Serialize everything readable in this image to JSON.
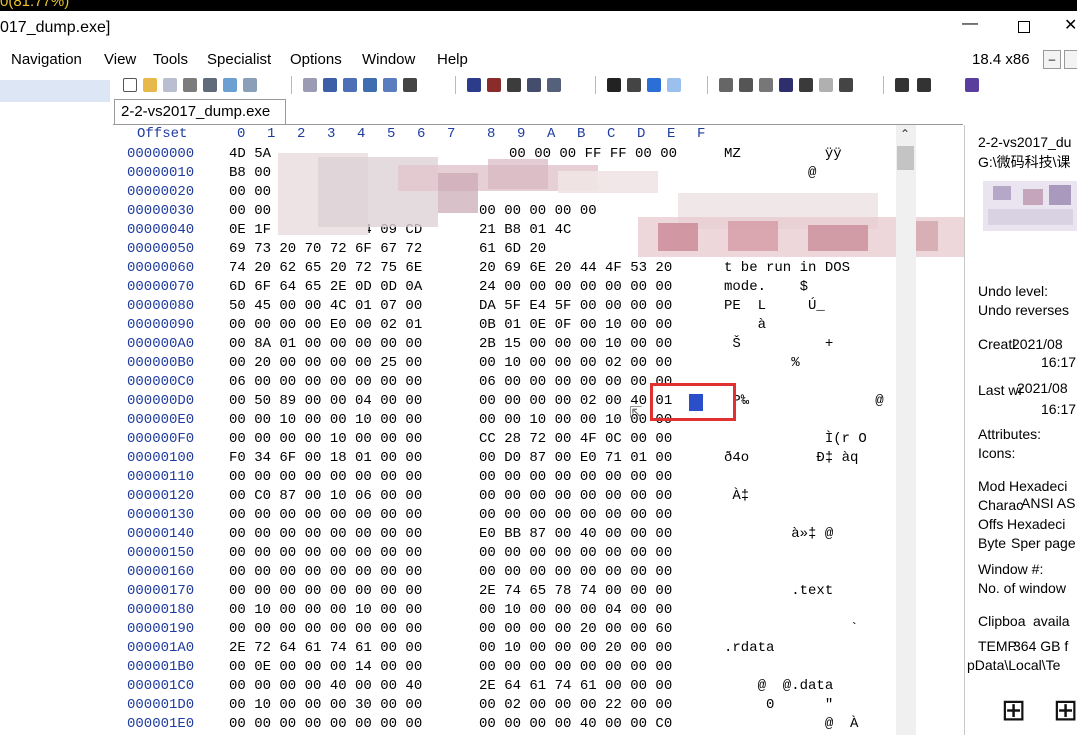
{
  "window": {
    "top_strip_text": "0(81.77%)",
    "title": "017_dump.exe]",
    "minimize_glyph": "—",
    "close_glyph": "✕"
  },
  "menu": {
    "items": [
      "Navigation",
      "View",
      "Tools",
      "Specialist",
      "Options",
      "Window",
      "Help"
    ],
    "version": "18.4 x86",
    "mini_button": "–"
  },
  "tab": {
    "label": "2-2-vs2017_dump.exe"
  },
  "hex": {
    "offset_header": "Offset",
    "columns": [
      "0",
      "1",
      "2",
      "3",
      "4",
      "5",
      "6",
      "7",
      "8",
      "9",
      "A",
      "B",
      "C",
      "D",
      "E",
      "F"
    ],
    "selected_byte": "01",
    "rows": [
      {
        "offset": "00000000",
        "b1": "4D 5A",
        "b2": "00 00 00 FF FF 00 00",
        "ascii": "MZ          ÿÿ"
      },
      {
        "offset": "00000010",
        "b1": "B8 00",
        "b2": "",
        "ascii": "          @"
      },
      {
        "offset": "00000020",
        "b1": "00 00",
        "b2": "",
        "ascii": ""
      },
      {
        "offset": "00000030",
        "b1": "00 00 00",
        "b2": "00 00 00 00 00",
        "ascii": ""
      },
      {
        "offset": "00000040",
        "b1": "0E 1F BA 0E 00 B4 09 CD",
        "b2": "21 B8 01 4C",
        "ascii": ""
      },
      {
        "offset": "00000050",
        "b1": "69 73 20 70 72 6F 67 72",
        "b2": "61 6D 20",
        "ascii": ""
      },
      {
        "offset": "00000060",
        "b1": "74 20 62 65 20 72 75 6E",
        "b2": "20 69 6E 20 44 4F 53 20",
        "ascii": "t be run in DOS"
      },
      {
        "offset": "00000070",
        "b1": "6D 6F 64 65 2E 0D 0D 0A",
        "b2": "24 00 00 00 00 00 00 00",
        "ascii": "mode.    $"
      },
      {
        "offset": "00000080",
        "b1": "50 45 00 00 4C 01 07 00",
        "b2": "DA 5F E4 5F 00 00 00 00",
        "ascii": "PE  L     Ú_"
      },
      {
        "offset": "00000090",
        "b1": "00 00 00 00 E0 00 02 01",
        "b2": "0B 01 0E 0F 00 10 00 00",
        "ascii": "    à"
      },
      {
        "offset": "000000A0",
        "b1": "00 8A 01 00 00 00 00 00",
        "b2": "2B 15 00 00 00 10 00 00",
        "ascii": " Š          +"
      },
      {
        "offset": "000000B0",
        "b1": "00 20 00 00 00 00 25 00",
        "b2": "00 10 00 00 00 02 00 00",
        "ascii": "        %"
      },
      {
        "offset": "000000C0",
        "b1": "06 00 00 00 00 00 00 00",
        "b2": "06 00 00 00 00 00 00 00",
        "ascii": ""
      },
      {
        "offset": "000000D0",
        "b1": "00 50 89 00 00 04 00 00",
        "b2": "00 00 00 00 02 00 40 01",
        "ascii": " P‰               @"
      },
      {
        "offset": "000000E0",
        "b1": "00 00 10 00 00 10 00 00",
        "b2": "00 00 10 00 00 10 00 00",
        "ascii": ""
      },
      {
        "offset": "000000F0",
        "b1": "00 00 00 00 10 00 00 00",
        "b2": "CC 28 72 00 4F 0C 00 00",
        "ascii": "            Ì(r O"
      },
      {
        "offset": "00000100",
        "b1": "F0 34 6F 00 18 01 00 00",
        "b2": "00 D0 87 00 E0 71 01 00",
        "ascii": "ð4o        Ð‡ àq"
      },
      {
        "offset": "00000110",
        "b1": "00 00 00 00 00 00 00 00",
        "b2": "00 00 00 00 00 00 00 00",
        "ascii": ""
      },
      {
        "offset": "00000120",
        "b1": "00 C0 87 00 10 06 00 00",
        "b2": "00 00 00 00 00 00 00 00",
        "ascii": " À‡"
      },
      {
        "offset": "00000130",
        "b1": "00 00 00 00 00 00 00 00",
        "b2": "00 00 00 00 00 00 00 00",
        "ascii": ""
      },
      {
        "offset": "00000140",
        "b1": "00 00 00 00 00 00 00 00",
        "b2": "E0 BB 87 00 40 00 00 00",
        "ascii": "        à»‡ @"
      },
      {
        "offset": "00000150",
        "b1": "00 00 00 00 00 00 00 00",
        "b2": "00 00 00 00 00 00 00 00",
        "ascii": ""
      },
      {
        "offset": "00000160",
        "b1": "00 00 00 00 00 00 00 00",
        "b2": "00 00 00 00 00 00 00 00",
        "ascii": ""
      },
      {
        "offset": "00000170",
        "b1": "00 00 00 00 00 00 00 00",
        "b2": "2E 74 65 78 74 00 00 00",
        "ascii": "        .text"
      },
      {
        "offset": "00000180",
        "b1": "00 10 00 00 00 10 00 00",
        "b2": "00 10 00 00 00 04 00 00",
        "ascii": ""
      },
      {
        "offset": "00000190",
        "b1": "00 00 00 00 00 00 00 00",
        "b2": "00 00 00 00 20 00 00 60",
        "ascii": "               `"
      },
      {
        "offset": "000001A0",
        "b1": "2E 72 64 61 74 61 00 00",
        "b2": "00 10 00 00 00 20 00 00",
        "ascii": ".rdata"
      },
      {
        "offset": "000001B0",
        "b1": "00 0E 00 00 00 14 00 00",
        "b2": "00 00 00 00 00 00 00 00",
        "ascii": ""
      },
      {
        "offset": "000001C0",
        "b1": "00 00 00 00 40 00 00 40",
        "b2": "2E 64 61 74 61 00 00 00",
        "ascii": "    @  @.data"
      },
      {
        "offset": "000001D0",
        "b1": "00 10 00 00 00 30 00 00",
        "b2": "00 02 00 00 00 22 00 00",
        "ascii": "     0      \""
      },
      {
        "offset": "000001E0",
        "b1": "00 00 00 00 00 00 00 00",
        "b2": "00 00 00 00 40 00 00 C0",
        "ascii": "            @  À"
      }
    ]
  },
  "info_panel": {
    "file_name": "2-2-vs2017_du",
    "path": "G:\\微码科技\\课",
    "undo_level": "Undo level:",
    "undo_reverses": "Undo reverses",
    "creation_label": "Creati",
    "creation_overlap": "2021/08",
    "creation_time": "16:17",
    "lastwrite_label": "Last wr",
    "lastwrite_overlap": "2021/08",
    "lastwrite_time": "16:17",
    "attributes": "Attributes:",
    "icons": "Icons:",
    "mode_label": "Mod",
    "mode_overlap": "Hexadeci",
    "charset_label": "Charac",
    "charset_overlap": "ANSI AS",
    "offsets_label": "Offs",
    "offsets_overlap": "Hexadeci",
    "bytes_label": "Byte",
    "bytes_overlap": "Sper page",
    "window_no": "Window #:",
    "no_windows": "No. of window",
    "clipboard_label": "Clipboa",
    "clipboard_overlap": "availa",
    "temp_label": "TEMP",
    "temp_overlap": "364 GB f",
    "temp_path": "pData\\Local\\Te"
  },
  "colors": {
    "offset_blue": "#1f3c9f",
    "highlight_red": "#e03030",
    "selection_blue": "#2a4fc9"
  }
}
